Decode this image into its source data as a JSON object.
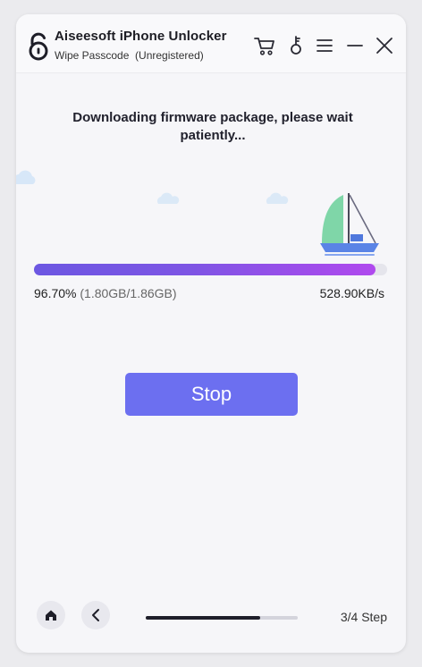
{
  "app": {
    "title": "Aiseesoft iPhone Unlocker",
    "subtitle": "Wipe Passcode  (Unregistered)"
  },
  "titlebar": {
    "icons": [
      "cart-icon",
      "key-icon",
      "menu-icon",
      "minimize-icon",
      "close-icon"
    ]
  },
  "download": {
    "message": "Downloading firmware package, please wait patiently...",
    "percent_text": "96.70%",
    "size_text": "(1.80GB/1.86GB)",
    "speed_text": "528.90KB/s",
    "progress": 0.967
  },
  "actions": {
    "stop_label": "Stop"
  },
  "footer": {
    "step_label": "3/4 Step",
    "step_progress": 0.75
  },
  "colors": {
    "accent": "#6c6ff0",
    "progress_start": "#6c57e2",
    "progress_end": "#b049ee",
    "sail": "#7fd6a8",
    "boat_hull": "#5a84e6",
    "cloud": "#d9e8f8"
  }
}
